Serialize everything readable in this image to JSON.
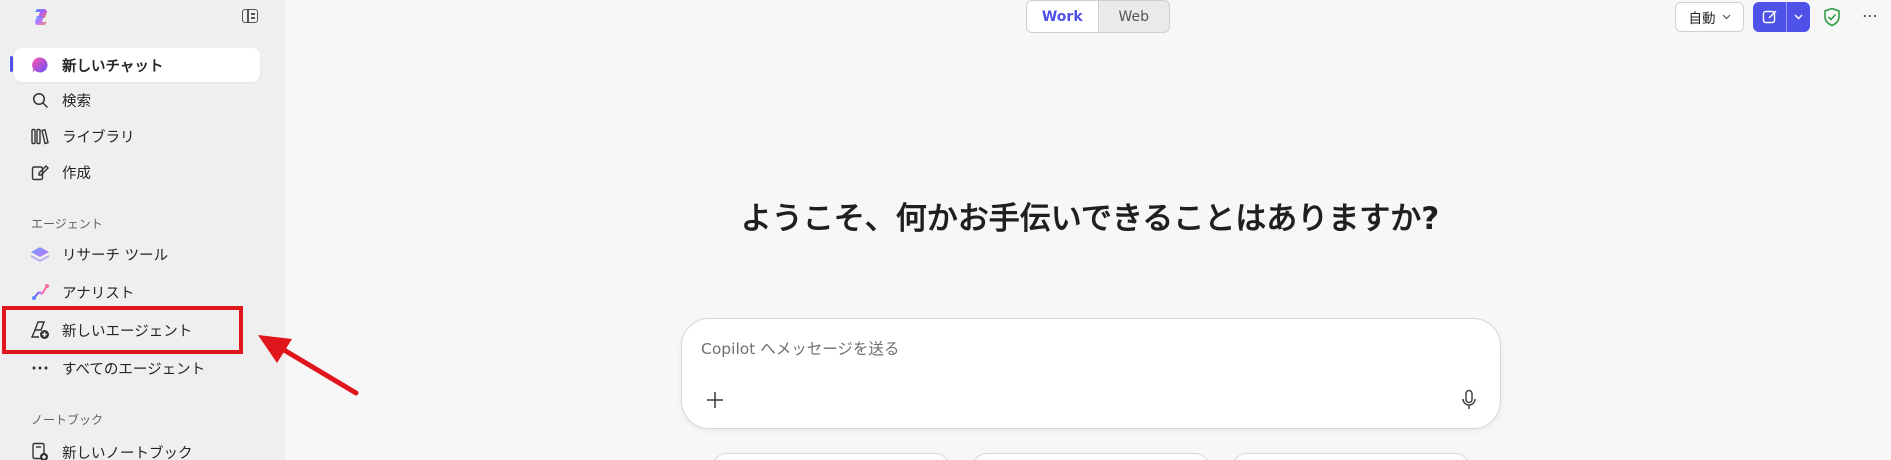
{
  "sidebar": {
    "items": [
      {
        "label": "新しいチャット",
        "icon": "copilot-chat-icon"
      },
      {
        "label": "検索",
        "icon": "search-icon"
      },
      {
        "label": "ライブラリ",
        "icon": "library-icon"
      },
      {
        "label": "作成",
        "icon": "create-icon"
      }
    ],
    "agents_label": "エージェント",
    "agents": [
      {
        "label": "リサーチ ツール",
        "icon": "research-tool-icon"
      },
      {
        "label": "アナリスト",
        "icon": "analyst-icon"
      },
      {
        "label": "新しいエージェント",
        "icon": "new-agent-icon"
      },
      {
        "label": "すべてのエージェント",
        "icon": "more-horizontal-icon"
      }
    ],
    "notebooks_label": "ノートブック",
    "notebooks": [
      {
        "label": "新しいノートブック",
        "icon": "new-notebook-icon"
      }
    ]
  },
  "header": {
    "mode_tabs": [
      "Work",
      "Web"
    ],
    "selected_mode": "Work",
    "model_select": "自動",
    "more_label": "⋯"
  },
  "main": {
    "welcome": "ようこそ、何かお手伝いできることはありますか?",
    "composer_placeholder": "Copilot へメッセージを送る"
  },
  "colors": {
    "accent": "#4f52e8",
    "highlight": "#e0161c",
    "shield": "#2e9e44"
  }
}
